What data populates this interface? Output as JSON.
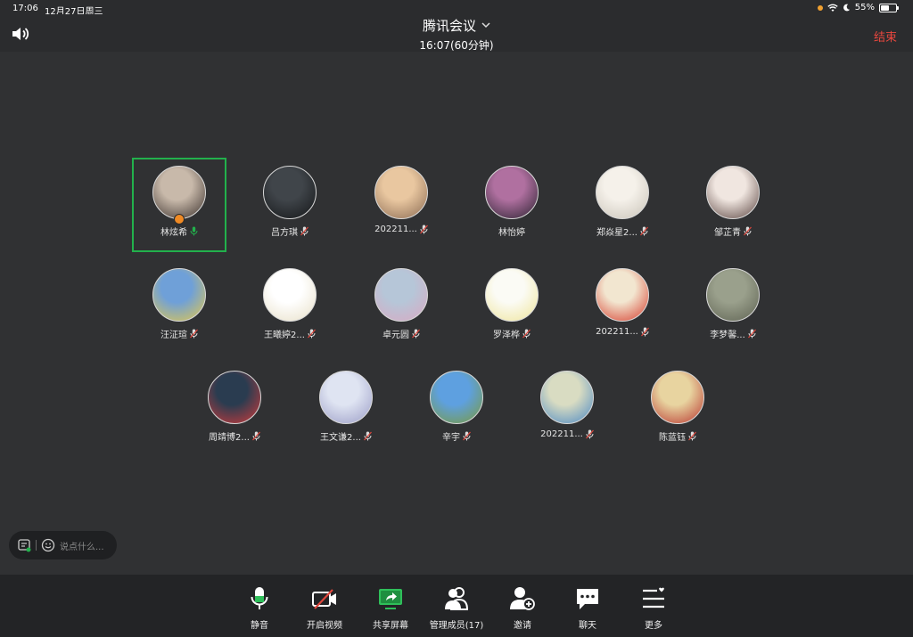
{
  "status": {
    "time": "17:06",
    "date": "12月27日周三",
    "battery": "55%",
    "battery_level": 0.55
  },
  "header": {
    "title": "腾讯会议",
    "subtitle": "16:07(60分钟)",
    "end_label": "结束"
  },
  "participants": [
    {
      "name": "林炫希",
      "mic": "on",
      "host": true,
      "active": true,
      "color1": "#c8b9aa",
      "color2": "#3a302c"
    },
    {
      "name": "吕方琪",
      "mic": "off",
      "color1": "#40454a",
      "color2": "#141618"
    },
    {
      "name": "202211...",
      "mic": "off",
      "color1": "#e9c7a0",
      "color2": "#8a6a52"
    },
    {
      "name": "林怡婷",
      "mic": "none",
      "color1": "#b070a0",
      "color2": "#2a2230"
    },
    {
      "name": "郑焱星2...",
      "mic": "off",
      "color1": "#f5f1ea",
      "color2": "#c9c3b8"
    },
    {
      "name": "邹芷青",
      "mic": "off",
      "color1": "#f0e6e0",
      "color2": "#5a4440"
    },
    {
      "name": "汪泟瑄",
      "mic": "off",
      "color1": "#6fa0d8",
      "color2": "#e4c84a"
    },
    {
      "name": "王曦婷2...",
      "mic": "off",
      "color1": "#ffffff",
      "color2": "#e8e0c8"
    },
    {
      "name": "卓元圆",
      "mic": "off",
      "color1": "#b6c6d8",
      "color2": "#d9a9c2"
    },
    {
      "name": "罗泽桦",
      "mic": "off",
      "color1": "#fbfbf5",
      "color2": "#efe59a"
    },
    {
      "name": "202211...",
      "mic": "off",
      "color1": "#f2e6d0",
      "color2": "#d63a2a"
    },
    {
      "name": "李梦馨...",
      "mic": "off",
      "color1": "#9aa08c",
      "color2": "#5e6252"
    },
    {
      "name": "周靖博2...",
      "mic": "off",
      "color1": "#2a3c50",
      "color2": "#d33a3a"
    },
    {
      "name": "王文谦2...",
      "mic": "off",
      "color1": "#dfe4f2",
      "color2": "#9a9cc6"
    },
    {
      "name": "辛宇",
      "mic": "off",
      "color1": "#5ea0e0",
      "color2": "#7a9a3a"
    },
    {
      "name": "202211...",
      "mic": "off",
      "color1": "#d9dcc2",
      "color2": "#4a88c4"
    },
    {
      "name": "陈蓝钰",
      "mic": "off",
      "color1": "#e8d4a0",
      "color2": "#b8342e"
    }
  ],
  "chat": {
    "placeholder": "说点什么..."
  },
  "toolbar": [
    {
      "id": "mute",
      "label": "静音",
      "icon": "microphone-icon"
    },
    {
      "id": "video",
      "label": "开启视频",
      "icon": "camera-off-icon"
    },
    {
      "id": "share",
      "label": "共享屏幕",
      "icon": "share-screen-icon"
    },
    {
      "id": "members",
      "label": "管理成员(17)",
      "icon": "members-icon"
    },
    {
      "id": "invite",
      "label": "邀请",
      "icon": "invite-icon"
    },
    {
      "id": "chat",
      "label": "聊天",
      "icon": "chat-icon"
    },
    {
      "id": "more",
      "label": "更多",
      "icon": "more-icon"
    }
  ],
  "colors": {
    "accent_green": "#22b14c",
    "end_red": "#e8473e",
    "mic_off_red": "#e0463c"
  }
}
